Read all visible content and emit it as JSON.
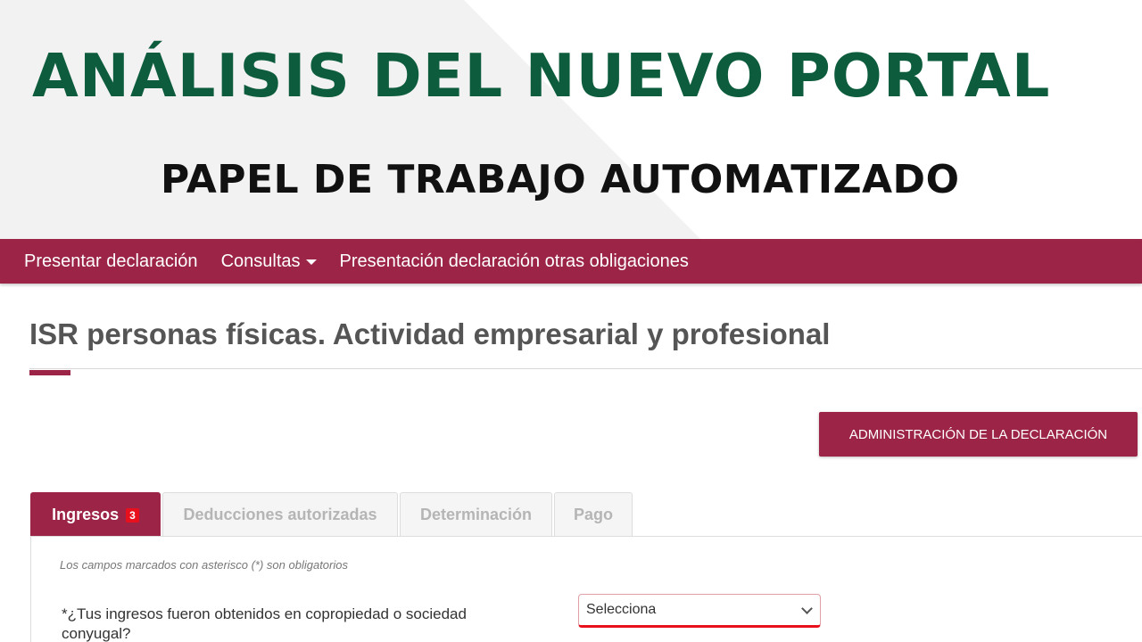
{
  "banner": {
    "title": "ANÁLISIS DEL NUEVO PORTAL",
    "subtitle": "PAPEL DE TRABAJO AUTOMATIZADO"
  },
  "nav": {
    "items": [
      {
        "label": "Presentar declaración"
      },
      {
        "label": "Consultas"
      },
      {
        "label": "Presentación declaración otras obligaciones"
      }
    ]
  },
  "page": {
    "title": "ISR personas físicas. Actividad empresarial y profesional",
    "admin_button": "ADMINISTRACIÓN DE LA DECLARACIÓN"
  },
  "tabs": [
    {
      "label": "Ingresos",
      "badge": "3",
      "active": true
    },
    {
      "label": "Deducciones autorizadas"
    },
    {
      "label": "Determinación"
    },
    {
      "label": "Pago"
    }
  ],
  "form": {
    "required_note": "Los campos marcados con asterisco (*) son obligatorios",
    "question": "*¿Tus ingresos fueron obtenidos en copropiedad o sociedad conyugal?",
    "select_value": "Selecciona"
  },
  "colors": {
    "brand_primary": "#9b2447",
    "title_green": "#0d5c3d",
    "badge_red": "#e8101c"
  }
}
